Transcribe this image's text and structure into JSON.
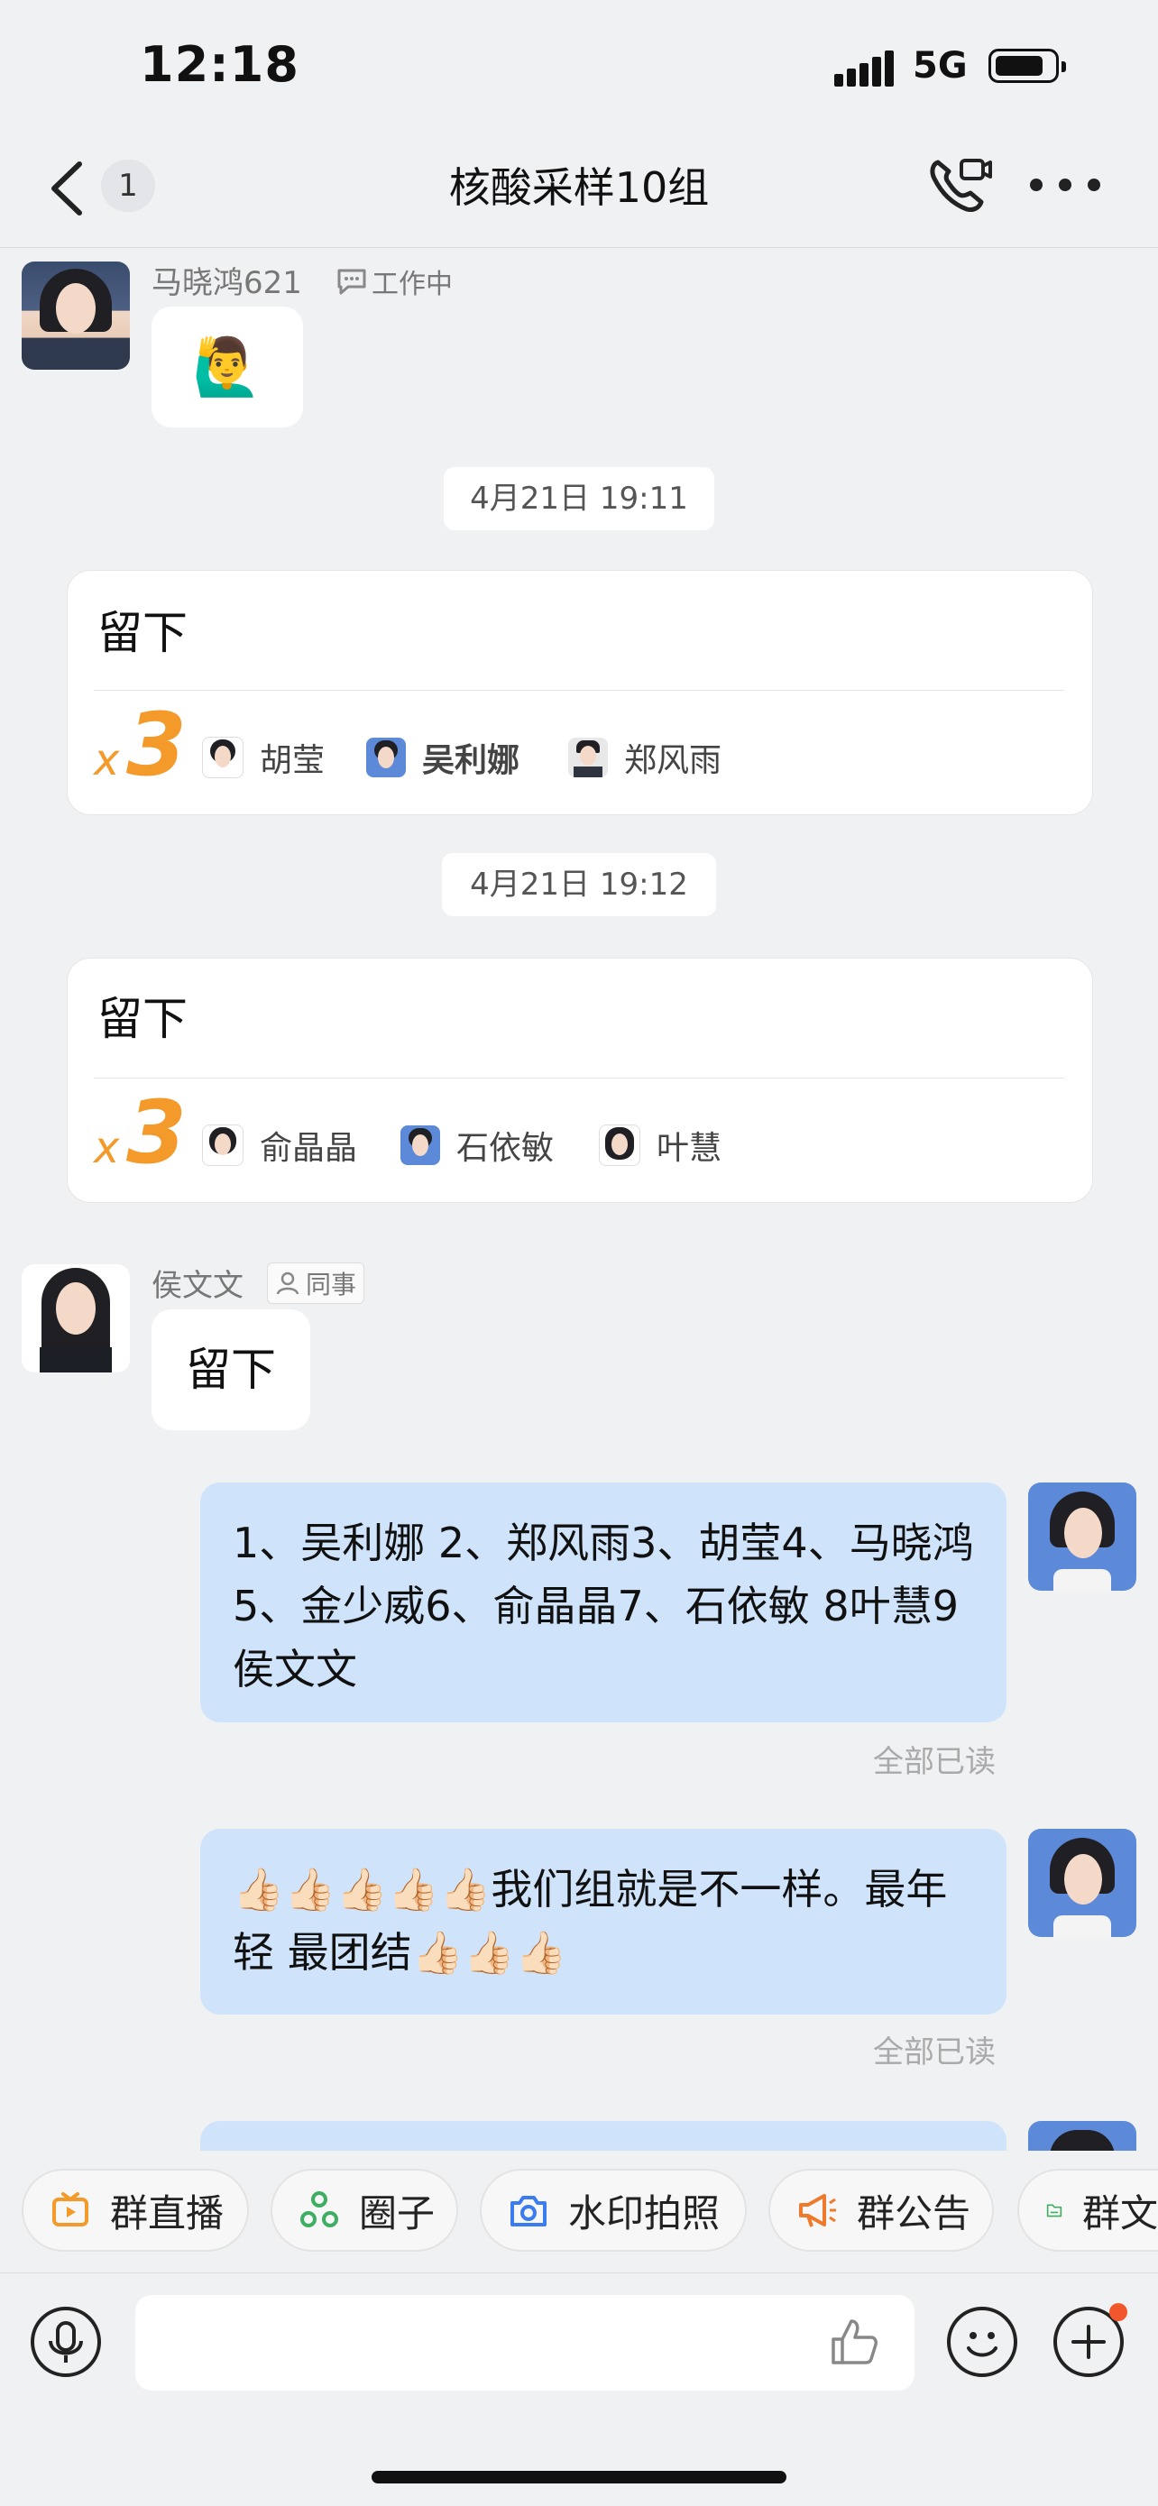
{
  "status": {
    "time": "12:18",
    "network": "5G"
  },
  "header": {
    "unread_count": "1",
    "title": "核酸采样10组"
  },
  "messages": {
    "m1": {
      "sender": "马晓鸿621",
      "tag": "工作中",
      "emoji": "🙋‍♂️"
    },
    "t1": "4月21日 19:11",
    "card1": {
      "text": "留下",
      "x": "x",
      "count": "3",
      "people": [
        "胡莹",
        "吴利娜",
        "郑风雨"
      ]
    },
    "t2": "4月21日 19:12",
    "card2": {
      "text": "留下",
      "x": "x",
      "count": "3",
      "people": [
        "俞晶晶",
        "石依敏",
        "叶慧"
      ]
    },
    "m2": {
      "sender": "侯文文",
      "tag": "同事",
      "text": "留下"
    },
    "m3": {
      "text": "1、吴利娜 2、郑风雨3、胡莹4、马晓鸿5、金少威6、俞晶晶7、石依敏  8叶慧9侯文文",
      "read": "全部已读"
    },
    "m4": {
      "text": "👍🏻👍🏻👍🏻👍🏻👍🏻我们组就是不一样。最年轻 最团结👍🏻👍🏻👍🏻",
      "read": "全部已读"
    }
  },
  "toolbar": [
    "群直播",
    "圈子",
    "水印拍照",
    "群公告",
    "群文"
  ],
  "colors": {
    "accent_orange": "#f39a2b",
    "bubble_blue": "#cfe4fb",
    "chip_live": "#f39a2b",
    "chip_circle": "#3fae62",
    "chip_camera": "#3b7cf0",
    "chip_notice": "#f07a2b",
    "chip_file": "#3fae62"
  },
  "icons": [
    "back-icon",
    "video-call-icon",
    "more-icon",
    "microphone-icon",
    "thumbs-up-icon",
    "emoji-icon",
    "plus-icon"
  ]
}
